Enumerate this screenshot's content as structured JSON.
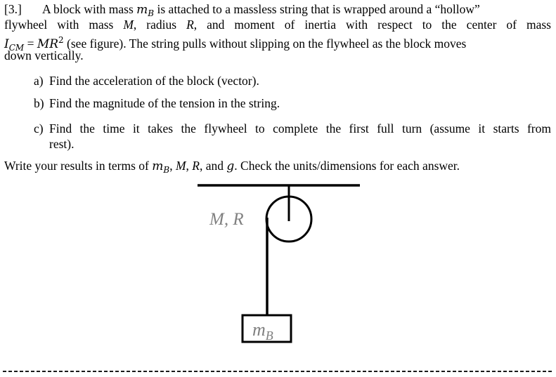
{
  "problem": {
    "number": "[3.]",
    "intro_lines": [
      {
        "pre": "A block with mass ",
        "var": "m",
        "sub": "B",
        "post": " is attached to a massless string that is wrapped around a “hollow”"
      },
      {
        "text": "flywheel with mass M, radius R, and moment of inertia with respect to the center of mass"
      },
      {
        "lhs": "I",
        "lhs_sub": "CM",
        "eq": " = ",
        "rhs": "MR",
        "rhs_sup": "2",
        "post": " (see figure). The string pulls without slipping on the flywheel as the block moves"
      },
      {
        "text": "down vertically."
      }
    ],
    "line2": {
      "a": "flywheel with mass ",
      "M": "M",
      "b": ", radius ",
      "R": "R",
      "c": ", and moment of inertia with respect to the center of mass"
    },
    "items": [
      {
        "label": "a)",
        "text": "Find the acceleration of the block (vector)."
      },
      {
        "label": "b)",
        "text": "Find the magnitude of the tension in the string."
      },
      {
        "label": "c)",
        "line1": "Find the time it takes the flywheel to complete the first full turn (assume it starts from",
        "line2": "rest)."
      }
    ],
    "write": {
      "pre": "Write your results in terms of ",
      "m": "m",
      "m_sub": "B",
      "sep1": ", ",
      "M": "M",
      "sep2": ", ",
      "R": "R",
      "sep3": ", and ",
      "g": "g",
      "post": ". Check the units/dimensions for each answer."
    }
  },
  "figure": {
    "flywheel_label": "M, R",
    "block_label": "m",
    "block_label_sub": "B",
    "label_color": "#808080"
  }
}
